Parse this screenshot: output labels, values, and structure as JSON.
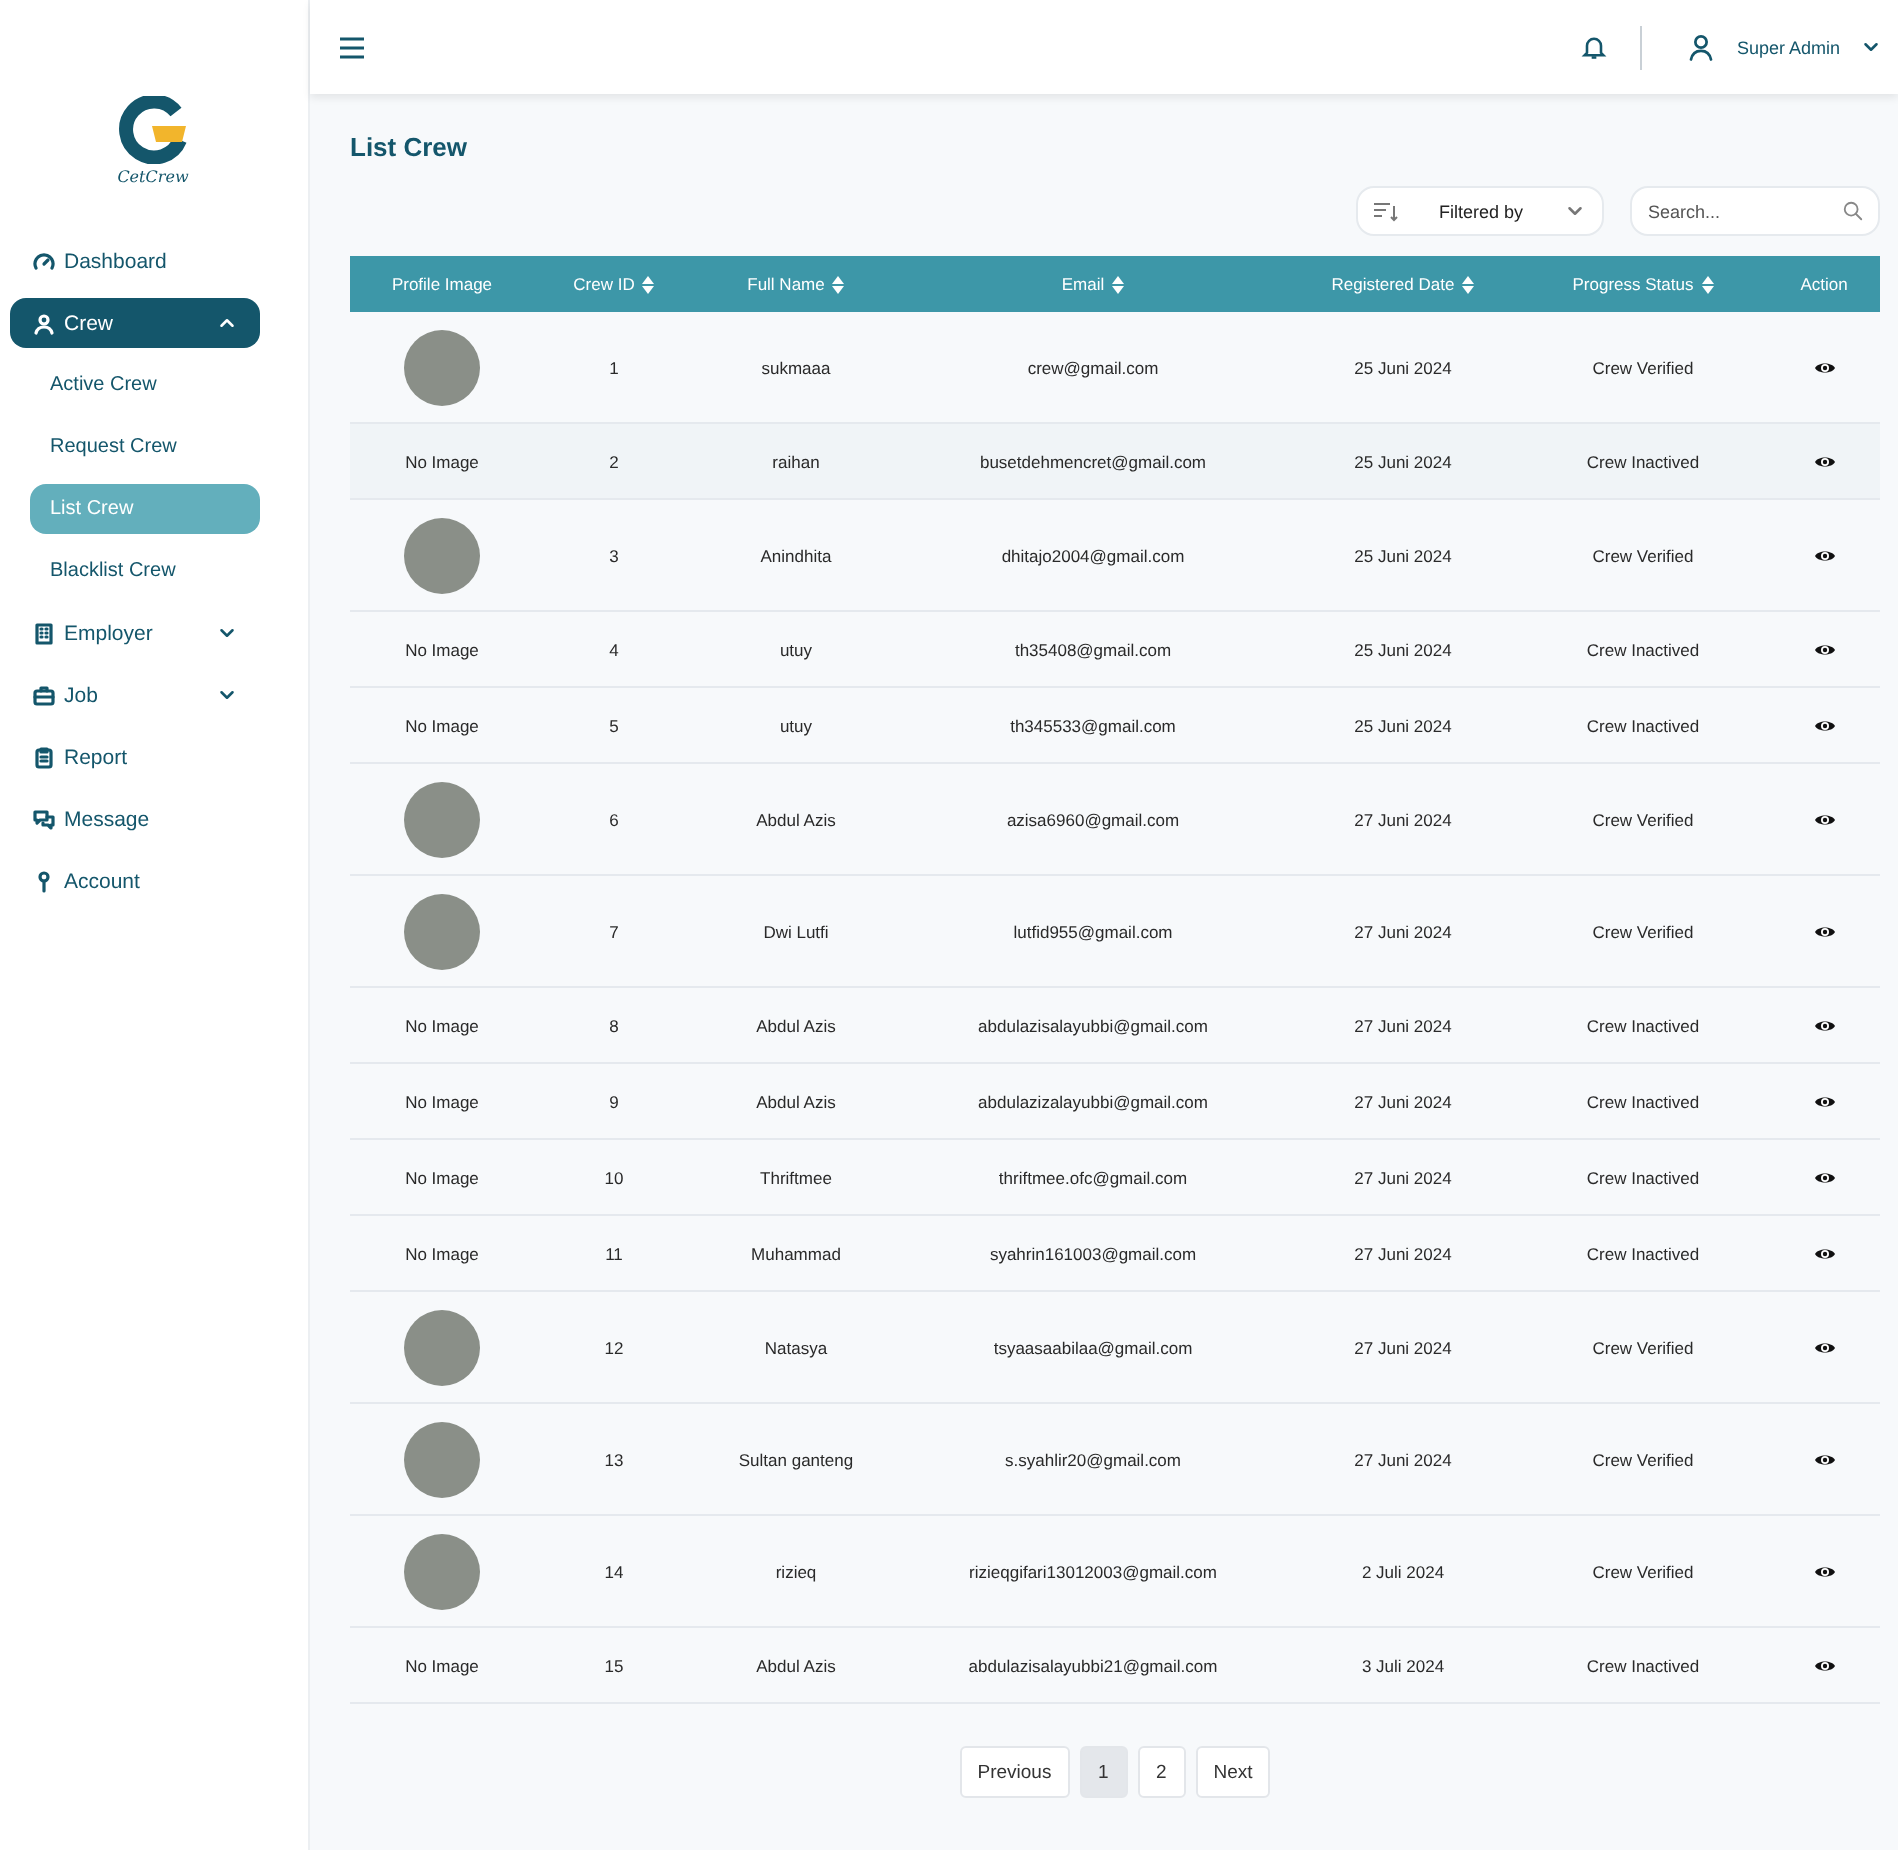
{
  "logo": {
    "text": "CetCrew"
  },
  "sidebar": {
    "items": [
      {
        "kind": "link",
        "label": "Dashboard",
        "selected": false
      },
      {
        "kind": "group",
        "label": "Crew",
        "expanded": true,
        "selected": true,
        "children": [
          {
            "label": "Active Crew",
            "selected": false
          },
          {
            "label": "Request Crew",
            "selected": false
          },
          {
            "label": "List Crew",
            "selected": true
          },
          {
            "label": "Blacklist Crew",
            "selected": false
          }
        ]
      },
      {
        "kind": "group",
        "label": "Employer",
        "expanded": false,
        "selected": false
      },
      {
        "kind": "group",
        "label": "Job",
        "expanded": false,
        "selected": false
      },
      {
        "kind": "link",
        "label": "Report",
        "selected": false
      },
      {
        "kind": "link",
        "label": "Message",
        "selected": false
      },
      {
        "kind": "link",
        "label": "Account",
        "selected": false
      }
    ]
  },
  "header": {
    "user": "Super Admin"
  },
  "page": {
    "title": "List Crew",
    "filter": {
      "label": "Filtered by"
    },
    "search": {
      "placeholder": "Search..."
    }
  },
  "table": {
    "columns": [
      {
        "label": "Profile Image",
        "sortable": false
      },
      {
        "label": "Crew ID",
        "sortable": true
      },
      {
        "label": "Full Name",
        "sortable": true
      },
      {
        "label": "Email",
        "sortable": true
      },
      {
        "label": "Registered Date",
        "sortable": true
      },
      {
        "label": "Progress Status",
        "sortable": true
      },
      {
        "label": "Action",
        "sortable": false
      }
    ],
    "rows": [
      {
        "photo": true,
        "id": "1",
        "name": "sukmaaa",
        "email": "crew@gmail.com",
        "date": "25 Juni 2024",
        "status": "Crew Verified",
        "highlighted": false
      },
      {
        "photo": false,
        "no_image": "No Image",
        "id": "2",
        "name": "raihan",
        "email": "busetdehmencret@gmail.com",
        "date": "25 Juni 2024",
        "status": "Crew Inactived",
        "highlighted": true
      },
      {
        "photo": true,
        "id": "3",
        "name": "Anindhita",
        "email": "dhitajo2004@gmail.com",
        "date": "25 Juni 2024",
        "status": "Crew Verified",
        "highlighted": false
      },
      {
        "photo": false,
        "no_image": "No Image",
        "id": "4",
        "name": "utuy",
        "email": "th35408@gmail.com",
        "date": "25 Juni 2024",
        "status": "Crew Inactived",
        "highlighted": false
      },
      {
        "photo": false,
        "no_image": "No Image",
        "id": "5",
        "name": "utuy",
        "email": "th345533@gmail.com",
        "date": "25 Juni 2024",
        "status": "Crew Inactived",
        "highlighted": false
      },
      {
        "photo": true,
        "id": "6",
        "name": "Abdul Azis",
        "email": "azisa6960@gmail.com",
        "date": "27 Juni 2024",
        "status": "Crew Verified",
        "highlighted": false
      },
      {
        "photo": true,
        "id": "7",
        "name": "Dwi Lutfi",
        "email": "lutfid955@gmail.com",
        "date": "27 Juni 2024",
        "status": "Crew Verified",
        "highlighted": false
      },
      {
        "photo": false,
        "no_image": "No Image",
        "id": "8",
        "name": "Abdul Azis",
        "email": "abdulazisalayubbi@gmail.com",
        "date": "27 Juni 2024",
        "status": "Crew Inactived",
        "highlighted": false
      },
      {
        "photo": false,
        "no_image": "No Image",
        "id": "9",
        "name": "Abdul Azis",
        "email": "abdulazizalayubbi@gmail.com",
        "date": "27 Juni 2024",
        "status": "Crew Inactived",
        "highlighted": false
      },
      {
        "photo": false,
        "no_image": "No Image",
        "id": "10",
        "name": "Thriftmee",
        "email": "thriftmee.ofc@gmail.com",
        "date": "27 Juni 2024",
        "status": "Crew Inactived",
        "highlighted": false
      },
      {
        "photo": false,
        "no_image": "No Image",
        "id": "11",
        "name": "Muhammad",
        "email": "syahrin161003@gmail.com",
        "date": "27 Juni 2024",
        "status": "Crew Inactived",
        "highlighted": false
      },
      {
        "photo": true,
        "id": "12",
        "name": "Natasya",
        "email": "tsyaasaabilaa@gmail.com",
        "date": "27 Juni 2024",
        "status": "Crew Verified",
        "highlighted": false
      },
      {
        "photo": true,
        "id": "13",
        "name": "Sultan ganteng",
        "email": "s.syahlir20@gmail.com",
        "date": "27 Juni 2024",
        "status": "Crew Verified",
        "highlighted": false
      },
      {
        "photo": true,
        "id": "14",
        "name": "rizieq",
        "email": "rizieqgifari13012003@gmail.com",
        "date": "2 Juli 2024",
        "status": "Crew Verified",
        "highlighted": false
      },
      {
        "photo": false,
        "no_image": "No Image",
        "id": "15",
        "name": "Abdul Azis",
        "email": "abdulazisalayubbi21@gmail.com",
        "date": "3 Juli 2024",
        "status": "Crew Inactived",
        "highlighted": false
      }
    ]
  },
  "pagination": {
    "previous": "Previous",
    "next": "Next",
    "pages": [
      {
        "label": "1",
        "selected": true
      },
      {
        "label": "2",
        "selected": false
      }
    ]
  }
}
